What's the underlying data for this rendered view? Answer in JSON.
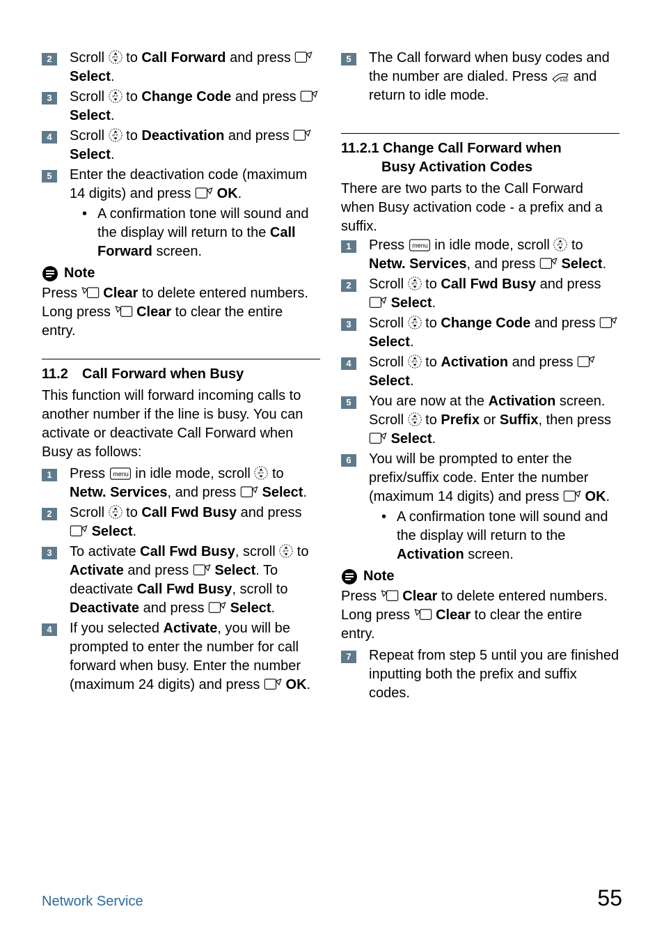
{
  "left": {
    "s2a": "Scroll ",
    "s2b": " to ",
    "s2c": "Call Forward",
    "s2d": " and press ",
    "s2e": "Select",
    "s3a": "Scroll ",
    "s3b": " to ",
    "s3c": "Change Code",
    "s3d": " and press ",
    "s3e": "Select",
    "s4a": "Scroll ",
    "s4b": " to ",
    "s4c": "Deactivation",
    "s4d": " and press ",
    "s4e": "Select",
    "s5a": "Enter the deactivation code (maximum 14 digits) and press ",
    "s5b": "OK",
    "b1a": "A confirmation tone will sound and the display will return to the ",
    "b1b": "Call Forward",
    "b1c": " screen.",
    "noteLabel": "Note",
    "note1a": "Press ",
    "note1b": "Clear",
    "note1c": " to delete entered numbers. Long press ",
    "note1d": "Clear",
    "note1e": " to clear the entire entry.",
    "h11_2_num": "11.2",
    "h11_2_title": "Call Forward when Busy",
    "p1": "This function will forward incoming calls to another number if the line is busy. You can activate or deactivate Call Forward when Busy as follows:",
    "bs1a": "Press ",
    "bs1b": " in idle mode, scroll ",
    "bs1c": " to ",
    "bs1d": "Netw. Services",
    "bs1e": ", and press ",
    "bs1f": "Select",
    "bs2a": "Scroll ",
    "bs2b": " to ",
    "bs2c": "Call Fwd Busy",
    "bs2d": " and press ",
    "bs2e": "Select",
    "bs3a": "To activate ",
    "bs3b": "Call Fwd Busy",
    "bs3c": ", scroll ",
    "bs3d": " to ",
    "bs3e": "Activate",
    "bs3f": " and press ",
    "bs3g": "Select",
    "bs3h": ". To deactivate ",
    "bs3i": "Call Fwd Busy",
    "bs3j": ", scroll to ",
    "bs3k": "Deactivate",
    "bs3l": " and press ",
    "bs3m": "Select",
    "bs4a": "If you selected ",
    "bs4b": "Activate",
    "bs4c": ", you will be prompted to enter the number for call forward when busy. Enter the number (maximum 24 digits) and press  ",
    "bs4d": "OK"
  },
  "right": {
    "s5a": "The Call forward when busy codes and the number are dialed. Press ",
    "s5b": " and return to idle mode.",
    "h11_2_1_l1": "11.2.1 Change Call Forward when",
    "h11_2_1_l2": "Busy Activation Codes",
    "p1": "There are two parts to the Call Forward when Busy activation code - a prefix and a suffix.",
    "s1a": "Press ",
    "s1b": " in idle mode, scroll ",
    "s1c": " to ",
    "s1d": "Netw. Services",
    "s1e": ", and press ",
    "s1f": "Select",
    "s2a": "Scroll ",
    "s2b": " to ",
    "s2c": "Call Fwd Busy",
    "s2d": " and press ",
    "s2e": "Select",
    "s3a": "Scroll ",
    "s3b": " to ",
    "s3c": "Change Code",
    "s3d": " and press ",
    "s3e": "Select",
    "s4a": "Scroll ",
    "s4b": " to ",
    "s4c": "Activation",
    "s4d": " and press ",
    "s4e": "Select",
    "s5xa": "You are now at the ",
    "s5xb": "Activation",
    "s5xc": " screen. Scroll ",
    "s5xd": " to ",
    "s5xe": "Prefix",
    "s5xf": " or ",
    "s5xg": "Suffix",
    "s5xh": ", then press ",
    "s5xi": "Select",
    "s6a": "You will be prompted to enter the prefix/suffix code. Enter the number (maximum 14 digits) and press ",
    "s6b": "OK",
    "b1a": "A confirmation tone will sound and the display will return to the ",
    "b1b": "Activation",
    "b1c": " screen.",
    "noteLabel": "Note",
    "n1a": "Press ",
    "n1b": "Clear",
    "n1c": " to delete entered numbers. Long press ",
    "n1d": "Clear",
    "n1e": " to clear the entire entry.",
    "s7": "Repeat from step 5 until you are finished inputting both the prefix and suffix codes."
  },
  "footer": {
    "section": "Network Service",
    "page": "55"
  },
  "nums": {
    "n1": "1",
    "n2": "2",
    "n3": "3",
    "n4": "4",
    "n5": "5",
    "n6": "6",
    "n7": "7"
  }
}
